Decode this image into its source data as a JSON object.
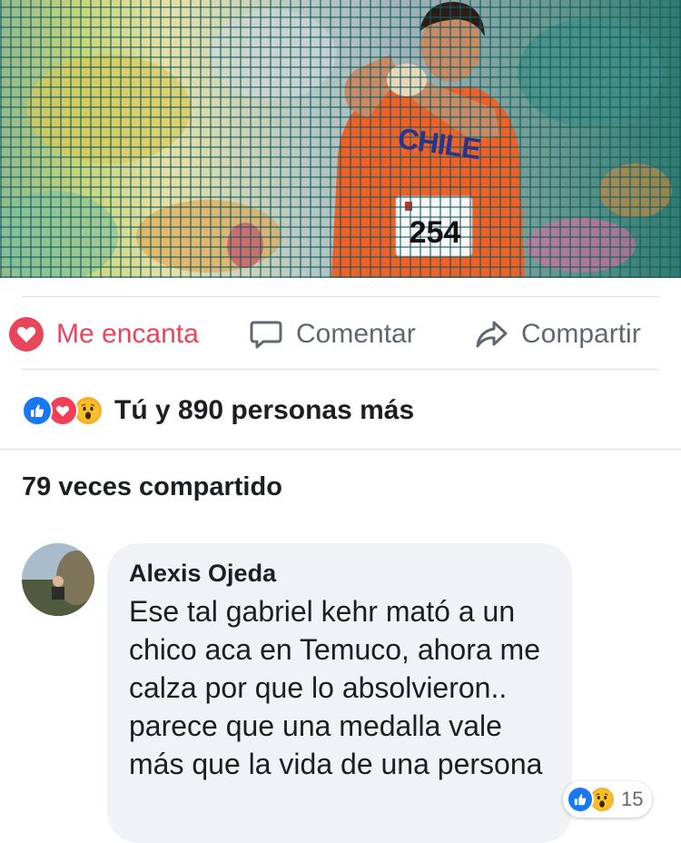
{
  "photo": {
    "jersey_text": "CHILE",
    "bib_number": "254"
  },
  "actions": {
    "love_label": "Me encanta",
    "comment_label": "Comentar",
    "share_label": "Compartir"
  },
  "reactions": {
    "icons": [
      "like-icon",
      "love-icon",
      "wow-icon"
    ],
    "summary_text": "Tú y 890 personas más"
  },
  "shares_text": "79 veces compartido",
  "comment": {
    "author": "Alexis Ojeda",
    "text": "Ese tal gabriel kehr mató a un chico aca en Temuco, ahora me calza por que lo absolvieron.. parece que una medalla vale más que la vida de una persona",
    "reaction_icons": [
      "like-icon",
      "wow-icon"
    ],
    "reaction_count": "15"
  },
  "colors": {
    "love_red": "#e8475b",
    "like_blue": "#1877f2",
    "muted_gray": "#606770",
    "bubble_bg": "#f0f2f5"
  }
}
